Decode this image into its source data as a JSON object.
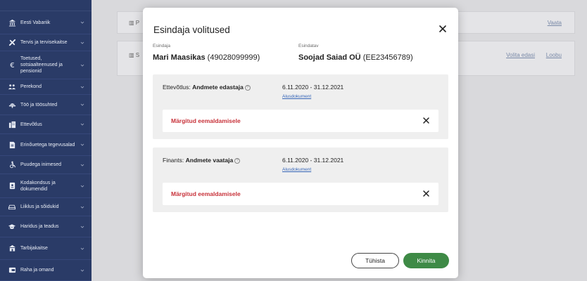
{
  "sidebar": {
    "items": [
      {
        "label": "Eesti Vabariik",
        "icon": "government-building-icon"
      },
      {
        "label": "Tervis ja tervisekaitse",
        "icon": "health-icon"
      },
      {
        "label": "Toetused, sotsiaalteenused ja pensionid",
        "icon": "euro-icon"
      },
      {
        "label": "Perekond",
        "icon": "family-icon"
      },
      {
        "label": "Töö ja töösuhted",
        "icon": "work-icon"
      },
      {
        "label": "Ettevõtlus",
        "icon": "business-icon"
      },
      {
        "label": "Erinõuetega tegevusalad",
        "icon": "special-requirements-icon"
      },
      {
        "label": "Puudega inimesed",
        "icon": "accessibility-icon"
      },
      {
        "label": "Kodakondsus ja dokumendid",
        "icon": "id-document-icon"
      },
      {
        "label": "Liiklus ja sõidukid",
        "icon": "car-icon"
      },
      {
        "label": "Haridus ja teadus",
        "icon": "education-icon"
      },
      {
        "label": "Tarbijakaitse",
        "icon": "consumer-protection-icon"
      },
      {
        "label": "Raha ja omand",
        "icon": "money-icon"
      }
    ]
  },
  "background": {
    "row1": {
      "prefix": "P",
      "link": "Vaata"
    },
    "row2": {
      "prefix": "S",
      "links": [
        "Volita edasi",
        "Loobu"
      ]
    }
  },
  "modal": {
    "title": "Esindaja volitused",
    "representative_label": "Esindaja",
    "representative_name": "Mari Maasikas",
    "representative_id": "(49028099999)",
    "represented_label": "Esindatav",
    "represented_name": "Soojad Saiad OÜ",
    "represented_id": "(EE23456789)",
    "sections": [
      {
        "category": "Ettevõtlus:",
        "role": "Andmete edastaja",
        "dates": "6.11.2020 - 31.12.2021",
        "doc_link": "Alusdokument",
        "status": "Märgitud eemaldamisele"
      },
      {
        "category": "Finants:",
        "role": "Andmete vaataja",
        "dates": "6.11.2020 - 31.12.2021",
        "doc_link": "Alusdokument",
        "status": "Märgitud eemaldamisele"
      }
    ],
    "cancel_label": "Tühista",
    "confirm_label": "Kinnita"
  },
  "colors": {
    "sidebar": "#2a3b67",
    "confirm": "#3e8a46",
    "danger": "#c8323a",
    "link": "#3867b8"
  }
}
